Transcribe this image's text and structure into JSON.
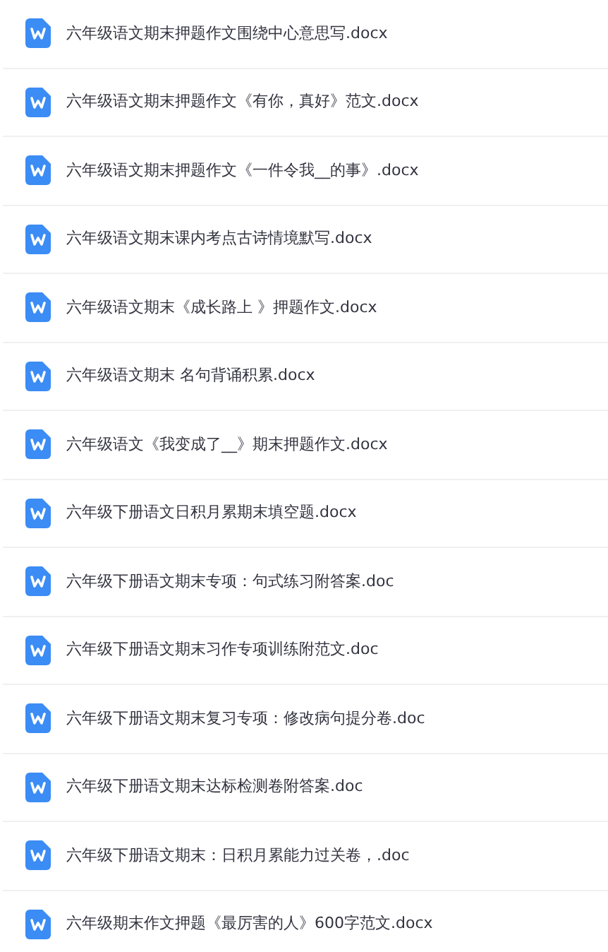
{
  "files": [
    {
      "name": "六年级语文期末押题作文围绕中心意思写.docx"
    },
    {
      "name": "六年级语文期末押题作文《有你，真好》范文.docx"
    },
    {
      "name": "六年级语文期末押题作文《一件令我__的事》.docx"
    },
    {
      "name": "六年级语文期末课内考点古诗情境默写.docx"
    },
    {
      "name": "六年级语文期末《成长路上 》押题作文.docx"
    },
    {
      "name": "六年级语文期末 名句背诵积累.docx"
    },
    {
      "name": "六年级语文《我变成了__》期末押题作文.docx"
    },
    {
      "name": "六年级下册语文日积月累期末填空题.docx"
    },
    {
      "name": "六年级下册语文期末专项：句式练习附答案.doc"
    },
    {
      "name": "六年级下册语文期末习作专项训练附范文.doc"
    },
    {
      "name": "六年级下册语文期末复习专项：修改病句提分卷.doc"
    },
    {
      "name": "六年级下册语文期末达标检测卷附答案.doc"
    },
    {
      "name": "六年级下册语文期末：日积月累能力过关卷，.doc"
    },
    {
      "name": "六年级期末作文押题《最厉害的人》600字范文.docx"
    }
  ]
}
